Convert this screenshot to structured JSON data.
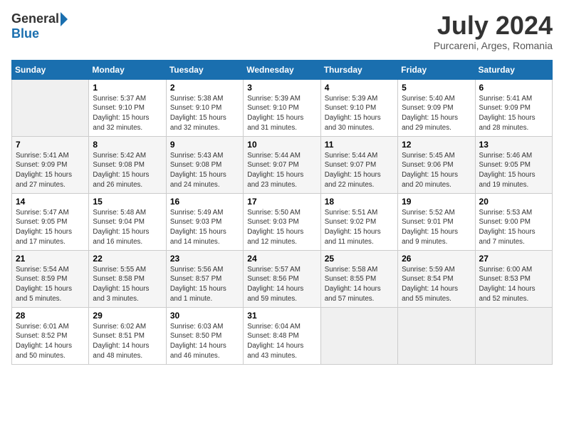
{
  "header": {
    "logo_general": "General",
    "logo_blue": "Blue",
    "month_year": "July 2024",
    "location": "Purcareni, Arges, Romania"
  },
  "weekdays": [
    "Sunday",
    "Monday",
    "Tuesday",
    "Wednesday",
    "Thursday",
    "Friday",
    "Saturday"
  ],
  "weeks": [
    [
      {
        "day": "",
        "info": ""
      },
      {
        "day": "1",
        "info": "Sunrise: 5:37 AM\nSunset: 9:10 PM\nDaylight: 15 hours\nand 32 minutes."
      },
      {
        "day": "2",
        "info": "Sunrise: 5:38 AM\nSunset: 9:10 PM\nDaylight: 15 hours\nand 32 minutes."
      },
      {
        "day": "3",
        "info": "Sunrise: 5:39 AM\nSunset: 9:10 PM\nDaylight: 15 hours\nand 31 minutes."
      },
      {
        "day": "4",
        "info": "Sunrise: 5:39 AM\nSunset: 9:10 PM\nDaylight: 15 hours\nand 30 minutes."
      },
      {
        "day": "5",
        "info": "Sunrise: 5:40 AM\nSunset: 9:09 PM\nDaylight: 15 hours\nand 29 minutes."
      },
      {
        "day": "6",
        "info": "Sunrise: 5:41 AM\nSunset: 9:09 PM\nDaylight: 15 hours\nand 28 minutes."
      }
    ],
    [
      {
        "day": "7",
        "info": "Sunrise: 5:41 AM\nSunset: 9:09 PM\nDaylight: 15 hours\nand 27 minutes."
      },
      {
        "day": "8",
        "info": "Sunrise: 5:42 AM\nSunset: 9:08 PM\nDaylight: 15 hours\nand 26 minutes."
      },
      {
        "day": "9",
        "info": "Sunrise: 5:43 AM\nSunset: 9:08 PM\nDaylight: 15 hours\nand 24 minutes."
      },
      {
        "day": "10",
        "info": "Sunrise: 5:44 AM\nSunset: 9:07 PM\nDaylight: 15 hours\nand 23 minutes."
      },
      {
        "day": "11",
        "info": "Sunrise: 5:44 AM\nSunset: 9:07 PM\nDaylight: 15 hours\nand 22 minutes."
      },
      {
        "day": "12",
        "info": "Sunrise: 5:45 AM\nSunset: 9:06 PM\nDaylight: 15 hours\nand 20 minutes."
      },
      {
        "day": "13",
        "info": "Sunrise: 5:46 AM\nSunset: 9:05 PM\nDaylight: 15 hours\nand 19 minutes."
      }
    ],
    [
      {
        "day": "14",
        "info": "Sunrise: 5:47 AM\nSunset: 9:05 PM\nDaylight: 15 hours\nand 17 minutes."
      },
      {
        "day": "15",
        "info": "Sunrise: 5:48 AM\nSunset: 9:04 PM\nDaylight: 15 hours\nand 16 minutes."
      },
      {
        "day": "16",
        "info": "Sunrise: 5:49 AM\nSunset: 9:03 PM\nDaylight: 15 hours\nand 14 minutes."
      },
      {
        "day": "17",
        "info": "Sunrise: 5:50 AM\nSunset: 9:03 PM\nDaylight: 15 hours\nand 12 minutes."
      },
      {
        "day": "18",
        "info": "Sunrise: 5:51 AM\nSunset: 9:02 PM\nDaylight: 15 hours\nand 11 minutes."
      },
      {
        "day": "19",
        "info": "Sunrise: 5:52 AM\nSunset: 9:01 PM\nDaylight: 15 hours\nand 9 minutes."
      },
      {
        "day": "20",
        "info": "Sunrise: 5:53 AM\nSunset: 9:00 PM\nDaylight: 15 hours\nand 7 minutes."
      }
    ],
    [
      {
        "day": "21",
        "info": "Sunrise: 5:54 AM\nSunset: 8:59 PM\nDaylight: 15 hours\nand 5 minutes."
      },
      {
        "day": "22",
        "info": "Sunrise: 5:55 AM\nSunset: 8:58 PM\nDaylight: 15 hours\nand 3 minutes."
      },
      {
        "day": "23",
        "info": "Sunrise: 5:56 AM\nSunset: 8:57 PM\nDaylight: 15 hours\nand 1 minute."
      },
      {
        "day": "24",
        "info": "Sunrise: 5:57 AM\nSunset: 8:56 PM\nDaylight: 14 hours\nand 59 minutes."
      },
      {
        "day": "25",
        "info": "Sunrise: 5:58 AM\nSunset: 8:55 PM\nDaylight: 14 hours\nand 57 minutes."
      },
      {
        "day": "26",
        "info": "Sunrise: 5:59 AM\nSunset: 8:54 PM\nDaylight: 14 hours\nand 55 minutes."
      },
      {
        "day": "27",
        "info": "Sunrise: 6:00 AM\nSunset: 8:53 PM\nDaylight: 14 hours\nand 52 minutes."
      }
    ],
    [
      {
        "day": "28",
        "info": "Sunrise: 6:01 AM\nSunset: 8:52 PM\nDaylight: 14 hours\nand 50 minutes."
      },
      {
        "day": "29",
        "info": "Sunrise: 6:02 AM\nSunset: 8:51 PM\nDaylight: 14 hours\nand 48 minutes."
      },
      {
        "day": "30",
        "info": "Sunrise: 6:03 AM\nSunset: 8:50 PM\nDaylight: 14 hours\nand 46 minutes."
      },
      {
        "day": "31",
        "info": "Sunrise: 6:04 AM\nSunset: 8:48 PM\nDaylight: 14 hours\nand 43 minutes."
      },
      {
        "day": "",
        "info": ""
      },
      {
        "day": "",
        "info": ""
      },
      {
        "day": "",
        "info": ""
      }
    ]
  ]
}
